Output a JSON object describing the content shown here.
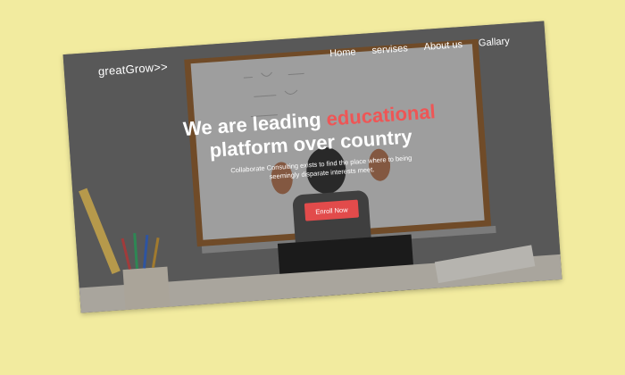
{
  "site": {
    "brand": "greatGrow>>",
    "nav": [
      {
        "label": "Home"
      },
      {
        "label": "servises"
      },
      {
        "label": "About us"
      },
      {
        "label": "Gallary"
      }
    ]
  },
  "hero": {
    "headline_line1_main": "We are leading ",
    "headline_line1_accent": "educational",
    "headline_line2": "platform over country",
    "subtext": "Collaborate Consulting exists to find the place where to being seemingly disparate interests meet.",
    "cta_label": "Enroll Now",
    "accent_color": "#ee5656",
    "cta_color": "#e24b4b"
  }
}
